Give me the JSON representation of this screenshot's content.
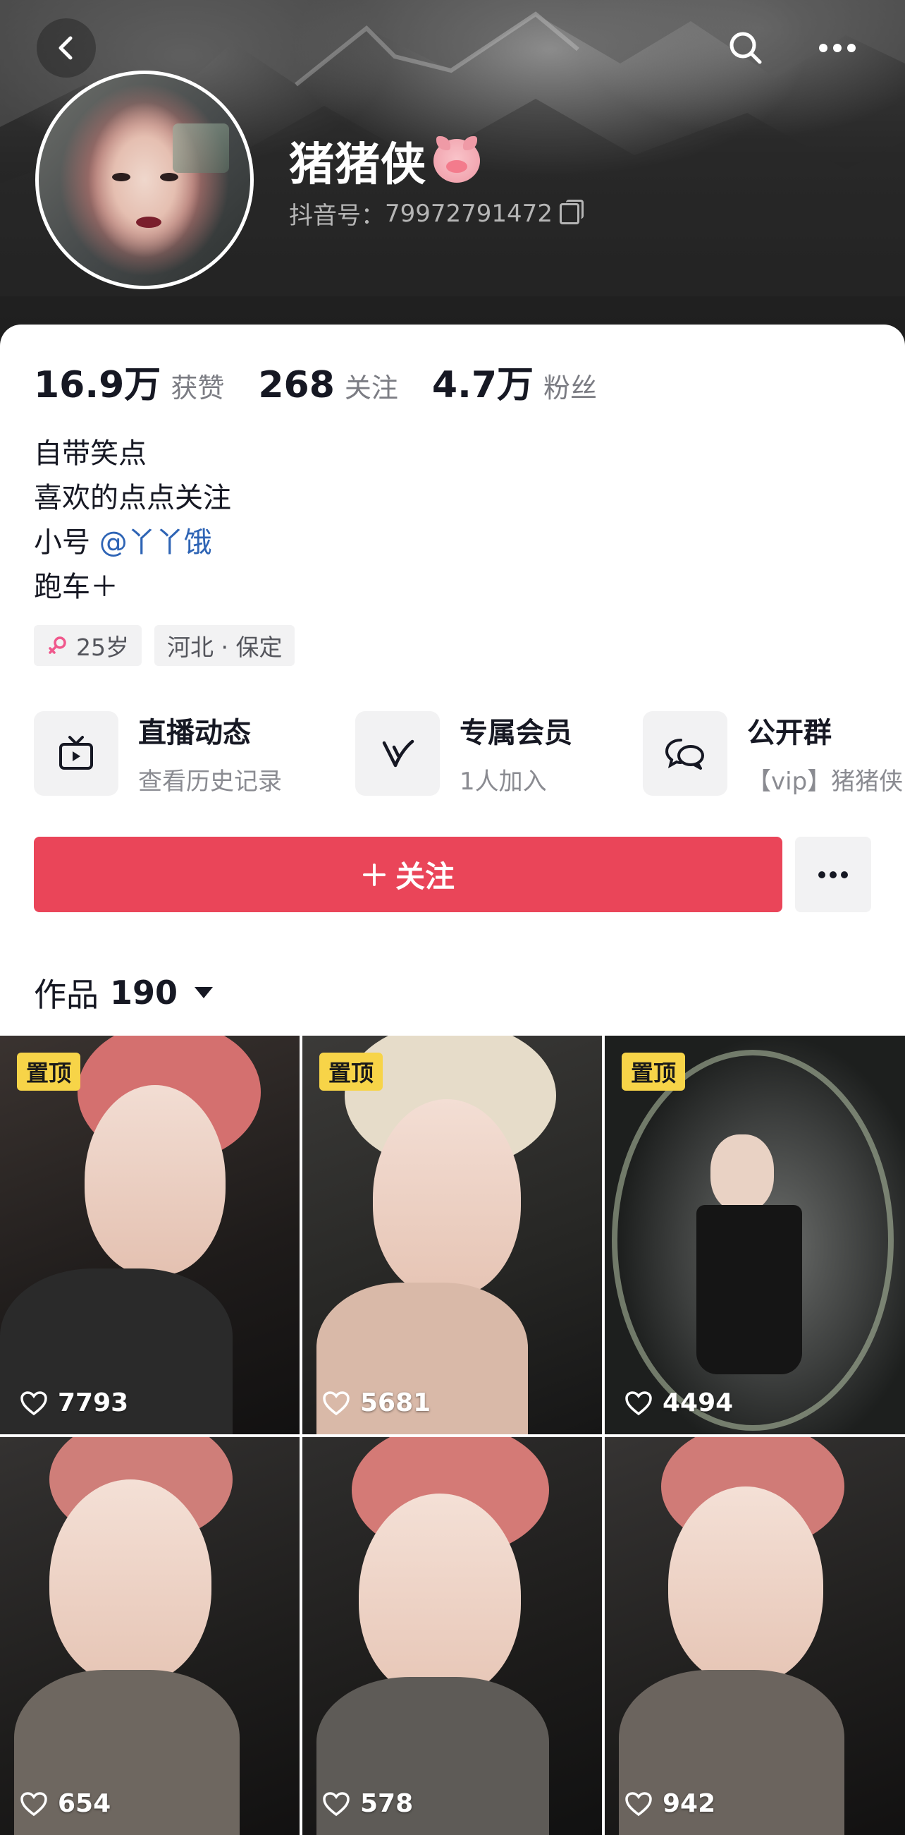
{
  "profile": {
    "name": "猪猪侠",
    "id_label": "抖音号：",
    "id_value": "79972791472"
  },
  "stats": [
    {
      "num": "16.9万",
      "label": "获赞"
    },
    {
      "num": "268",
      "label": "关注"
    },
    {
      "num": "4.7万",
      "label": "粉丝"
    }
  ],
  "bio": {
    "line1": "自带笑点",
    "line2": "喜欢的点点关注",
    "line3_prefix": "小号",
    "line3_link": "@丫丫饿",
    "line4": "跑车＋"
  },
  "tags": {
    "age": "25岁",
    "location": "河北 · 保定"
  },
  "features": [
    {
      "title": "直播动态",
      "subtitle": "查看历史记录",
      "icon": "tv-icon"
    },
    {
      "title": "专属会员",
      "subtitle": "1人加入",
      "icon": "v-icon"
    },
    {
      "title": "公开群",
      "subtitle": "【vip】猪猪侠",
      "icon": "chat-icon"
    }
  ],
  "actions": {
    "follow_label": "关注"
  },
  "works": {
    "label": "作品",
    "count": "190"
  },
  "videos": [
    {
      "likes": "7793",
      "pinned": "置顶"
    },
    {
      "likes": "5681",
      "pinned": "置顶"
    },
    {
      "likes": "4494",
      "pinned": "置顶"
    },
    {
      "likes": "654",
      "pinned": ""
    },
    {
      "likes": "578",
      "pinned": ""
    },
    {
      "likes": "942",
      "pinned": ""
    }
  ],
  "colors": {
    "follow_button": "#ea4559",
    "link": "#2e64b5",
    "pin_badge": "#f7d448"
  }
}
